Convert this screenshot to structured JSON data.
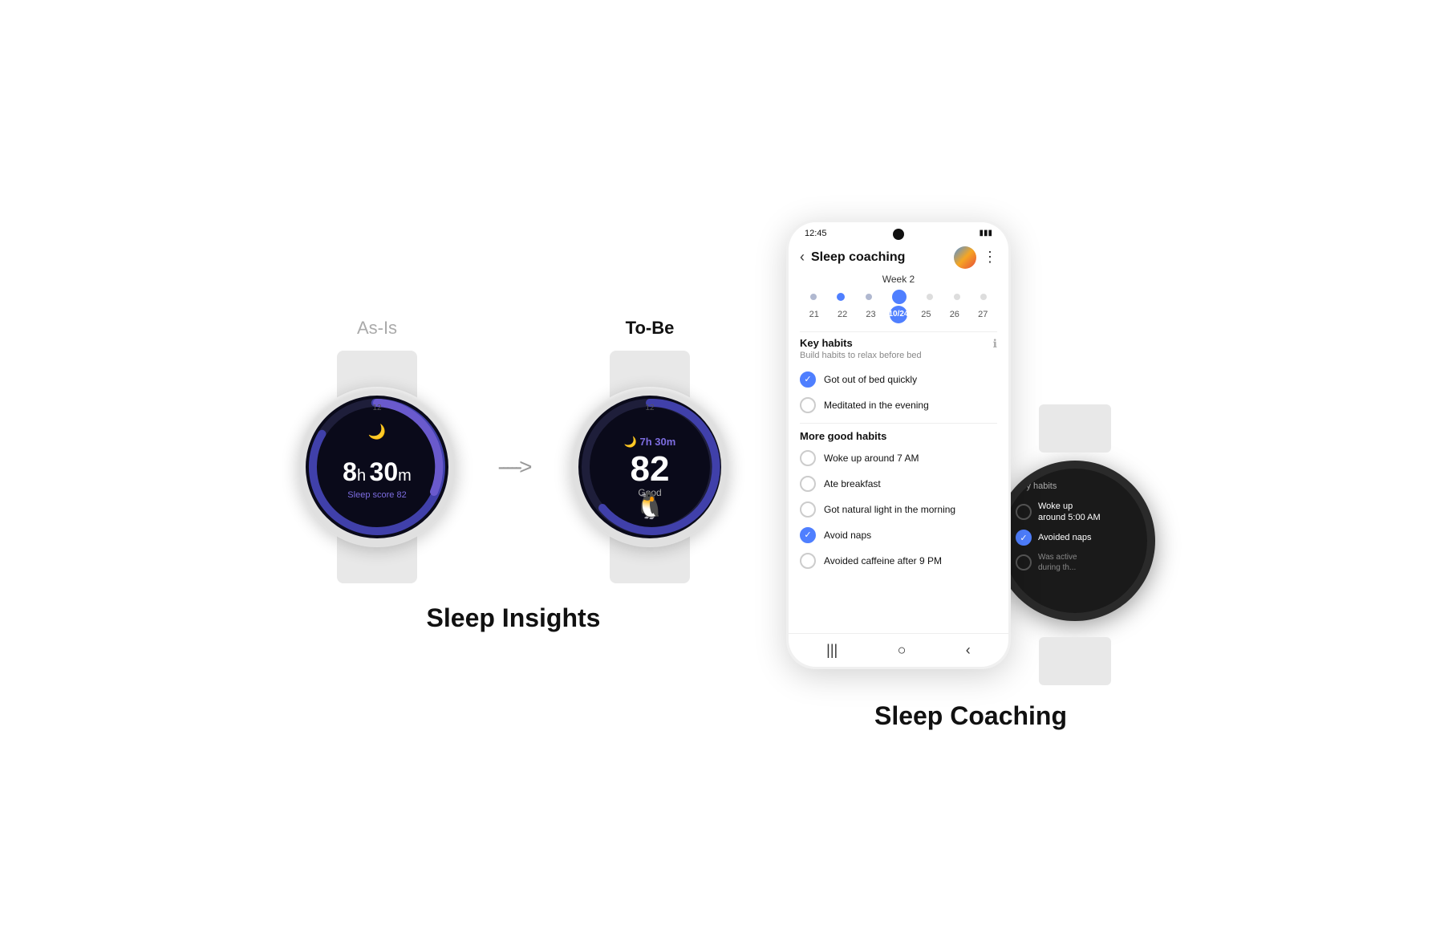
{
  "left_section": {
    "as_is_label": "As-Is",
    "to_be_label": "To-Be",
    "section_title": "Sleep Insights",
    "watch1": {
      "time_hours": "8",
      "time_h_unit": "h",
      "time_minutes": "30",
      "time_m_unit": "m",
      "sleep_score_label": "Sleep score",
      "sleep_score_value": "82",
      "label_12": "12"
    },
    "watch2": {
      "duration": "7h 30m",
      "score": "82",
      "score_quality": "Good",
      "label_12": "12"
    }
  },
  "right_section": {
    "section_title": "Sleep Coaching",
    "phone": {
      "status_time": "12:45",
      "header_title": "Sleep coaching",
      "week_label": "Week 2",
      "calendar": {
        "dates": [
          "21",
          "22",
          "23",
          "10/24",
          "25",
          "26",
          "27"
        ]
      },
      "key_habits_title": "Key habits",
      "key_habits_subtitle": "Build habits to relax before bed",
      "habits_key": [
        {
          "label": "Got out of bed quickly",
          "checked": true
        },
        {
          "label": "Meditated in the evening",
          "checked": false
        }
      ],
      "more_habits_title": "More good habits",
      "habits_more": [
        {
          "label": "Woke up around 7 AM",
          "checked": false
        },
        {
          "label": "Ate breakfast",
          "checked": false
        },
        {
          "label": "Got natural light in the morning",
          "checked": false
        },
        {
          "label": "Avoid naps",
          "checked": true
        },
        {
          "label": "Avoided caffeine after 9 PM",
          "checked": false
        }
      ]
    },
    "watch_overlay": {
      "title": "Key habits",
      "habits": [
        {
          "label": "Woke up around 5:00 AM",
          "checked": false
        },
        {
          "label": "Avoided naps",
          "checked": true
        },
        {
          "label": "Was active during th...",
          "checked": false,
          "dimmed": true
        }
      ]
    }
  }
}
